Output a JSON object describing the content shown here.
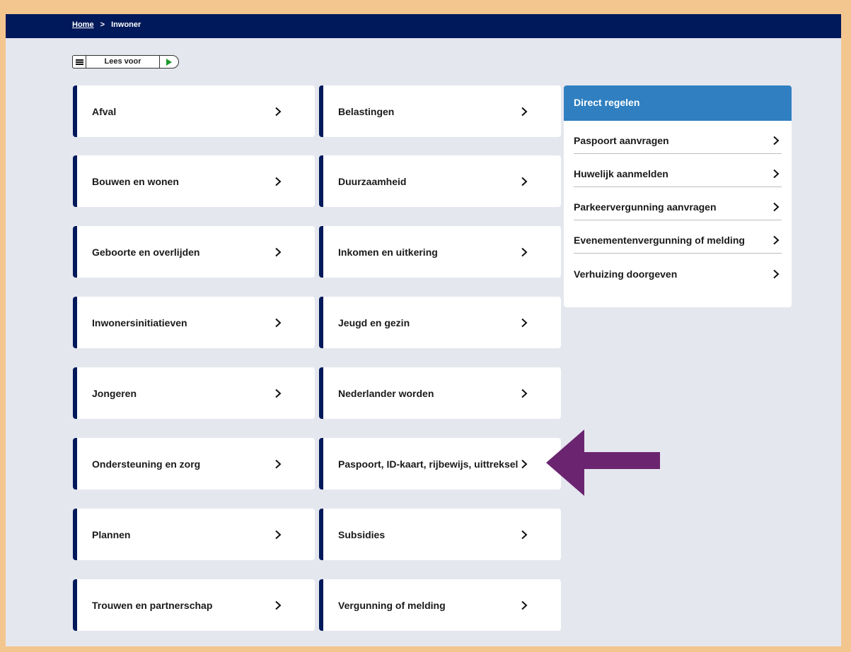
{
  "breadcrumb": {
    "home": "Home",
    "separator": ">",
    "current": "Inwoner"
  },
  "readspeaker": {
    "label": "Lees voor",
    "menu_icon": "menu-icon",
    "play_icon": "play-icon"
  },
  "tiles": {
    "col1": [
      "Afval",
      "Bouwen en wonen",
      "Geboorte en overlijden",
      "Inwonersinitiatieven",
      "Jongeren",
      "Ondersteuning en zorg",
      "Plannen",
      "Trouwen en partnerschap"
    ],
    "col2": [
      "Belastingen",
      "Duurzaamheid",
      "Inkomen en uitkering",
      "Jeugd en gezin",
      "Nederlander worden",
      "Paspoort, ID-kaart, rijbewijs, uittreksel",
      "Subsidies",
      "Vergunning of melding"
    ]
  },
  "direct_regelen": {
    "title": "Direct regelen",
    "items": [
      "Paspoort aanvragen",
      "Huwelijk aanmelden",
      "Parkeervergunning aanvragen",
      "Evenementenvergunning of melding",
      "Verhuizing doorgeven"
    ]
  },
  "colors": {
    "navy": "#00195a",
    "header_blue": "#2f7fc1",
    "background": "#e5e7ef",
    "border": "#f3c68f",
    "annotation_arrow": "#6b2570",
    "play_green": "#1e9a2e"
  }
}
